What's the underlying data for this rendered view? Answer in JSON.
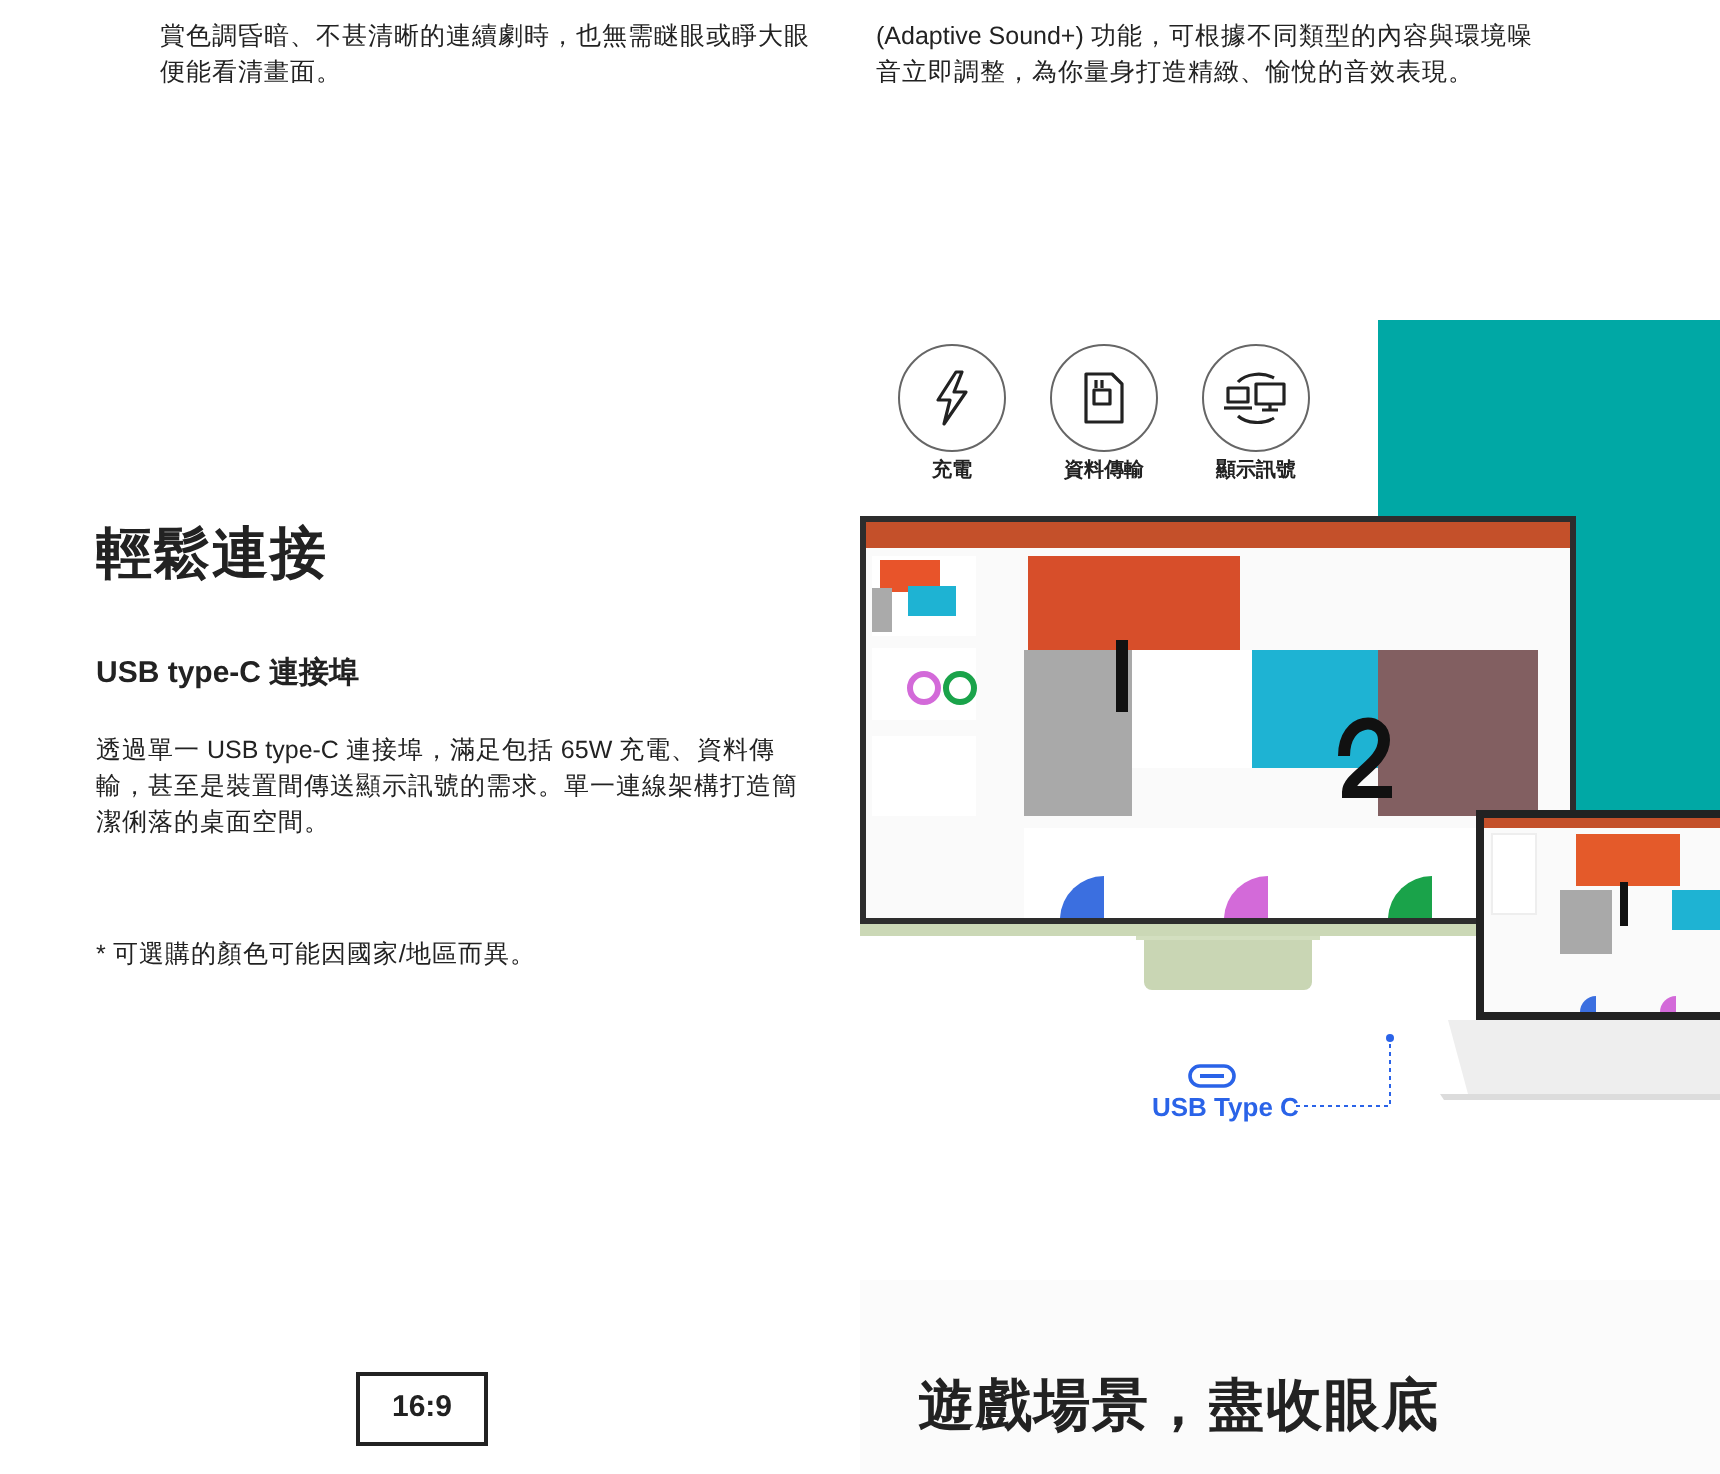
{
  "top_columns": [
    {
      "lines": [
        "賞色調昏暗、不甚清晰的連續劇時，也無需瞇眼或睜大眼",
        "便能看清畫面。"
      ]
    },
    {
      "lines": [
        "(Adaptive Sound+) 功能，可根據不同類型的內容與環境噪",
        "音立即調整，為你量身打造精緻、愉悅的音效表現。"
      ]
    }
  ],
  "section": {
    "title": "輕鬆連接",
    "subtitle": "USB type-C 連接埠",
    "body": "透過單一 USB type-C 連接埠，滿足包括 65W 充電、資料傳輸，甚至是裝置間傳送顯示訊號的需求。單一連線架構打造簡潔俐落的桌面空間。",
    "note": "* 可選購的顏色可能因國家/地區而異。"
  },
  "features": [
    {
      "kind": "charge",
      "label": "充電"
    },
    {
      "kind": "data",
      "label": "資料傳輸"
    },
    {
      "kind": "display",
      "label": "顯示訊號"
    }
  ],
  "port_label": "USB Type C",
  "bottom": {
    "badge": "16:9",
    "heading": "遊戲場景，盡收眼底"
  }
}
